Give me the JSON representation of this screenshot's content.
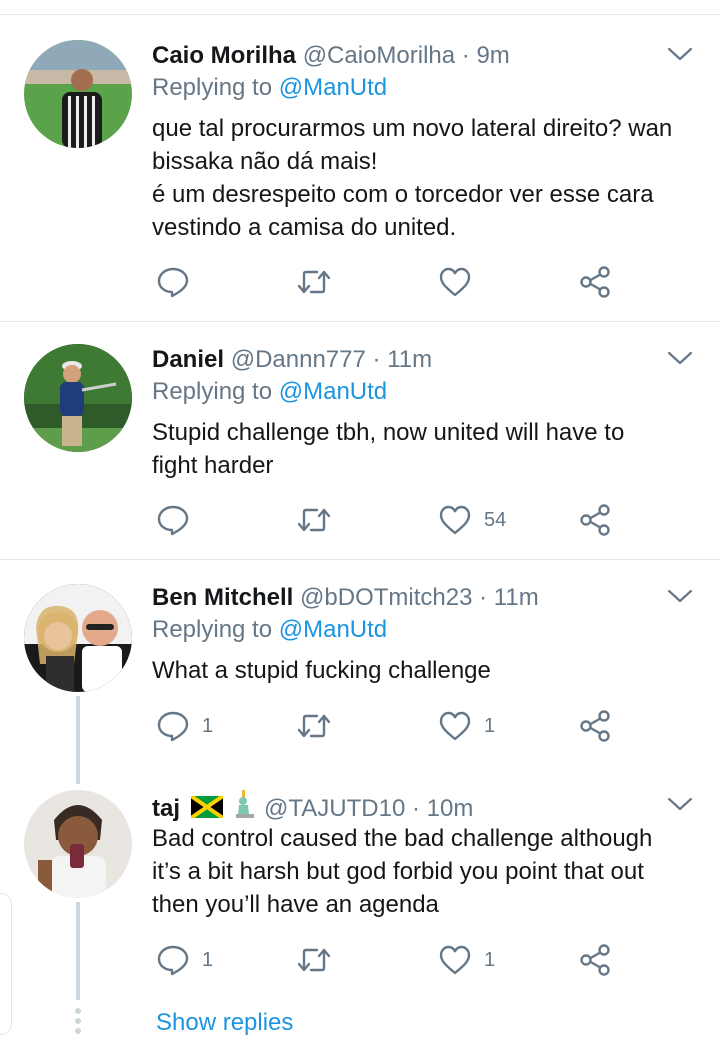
{
  "tweets": [
    {
      "name": "Caio Morilha",
      "handle": "@CaioMorilha",
      "time": "9m",
      "replying_prefix": "Replying to",
      "replying_to": "@ManUtd",
      "text_lines": [
        "que tal procurarmos um novo lateral direito? wan",
        "bissaka não dá mais!",
        "é um desrespeito com o torcedor ver esse cara",
        "vestindo a camisa do united."
      ],
      "reply_count": "",
      "retweet_count": "",
      "like_count": ""
    },
    {
      "name": "Daniel",
      "handle": "@Dannn777",
      "time": "11m",
      "replying_prefix": "Replying to",
      "replying_to": "@ManUtd",
      "text_lines": [
        "Stupid challenge tbh, now united will have to",
        "fight harder"
      ],
      "reply_count": "",
      "retweet_count": "",
      "like_count": "54"
    },
    {
      "name": "Ben Mitchell",
      "handle": "@bDOTmitch23",
      "time": "11m",
      "replying_prefix": "Replying to",
      "replying_to": "@ManUtd",
      "text_lines": [
        "What a stupid fucking challenge"
      ],
      "reply_count": "1",
      "retweet_count": "",
      "like_count": "1"
    },
    {
      "name": "taj",
      "name_emojis": [
        "jamaica-flag",
        "statue-of-liberty"
      ],
      "handle": "@TAJUTD10",
      "time": "10m",
      "text_lines": [
        "Bad control caused the bad challenge although",
        "it’s a bit harsh but god forbid you point that out",
        "then you’ll have an agenda"
      ],
      "reply_count": "1",
      "retweet_count": "",
      "like_count": "1"
    }
  ],
  "time_separator": "·",
  "show_replies_label": "Show replies",
  "colors": {
    "accent": "#1b95e0",
    "muted": "#657786",
    "divider": "#e1e8ed",
    "thread_line": "#ccd6dd",
    "text": "#14171a"
  },
  "icons": [
    "reply-icon",
    "retweet-icon",
    "like-icon",
    "share-icon",
    "chevron-down-icon"
  ]
}
